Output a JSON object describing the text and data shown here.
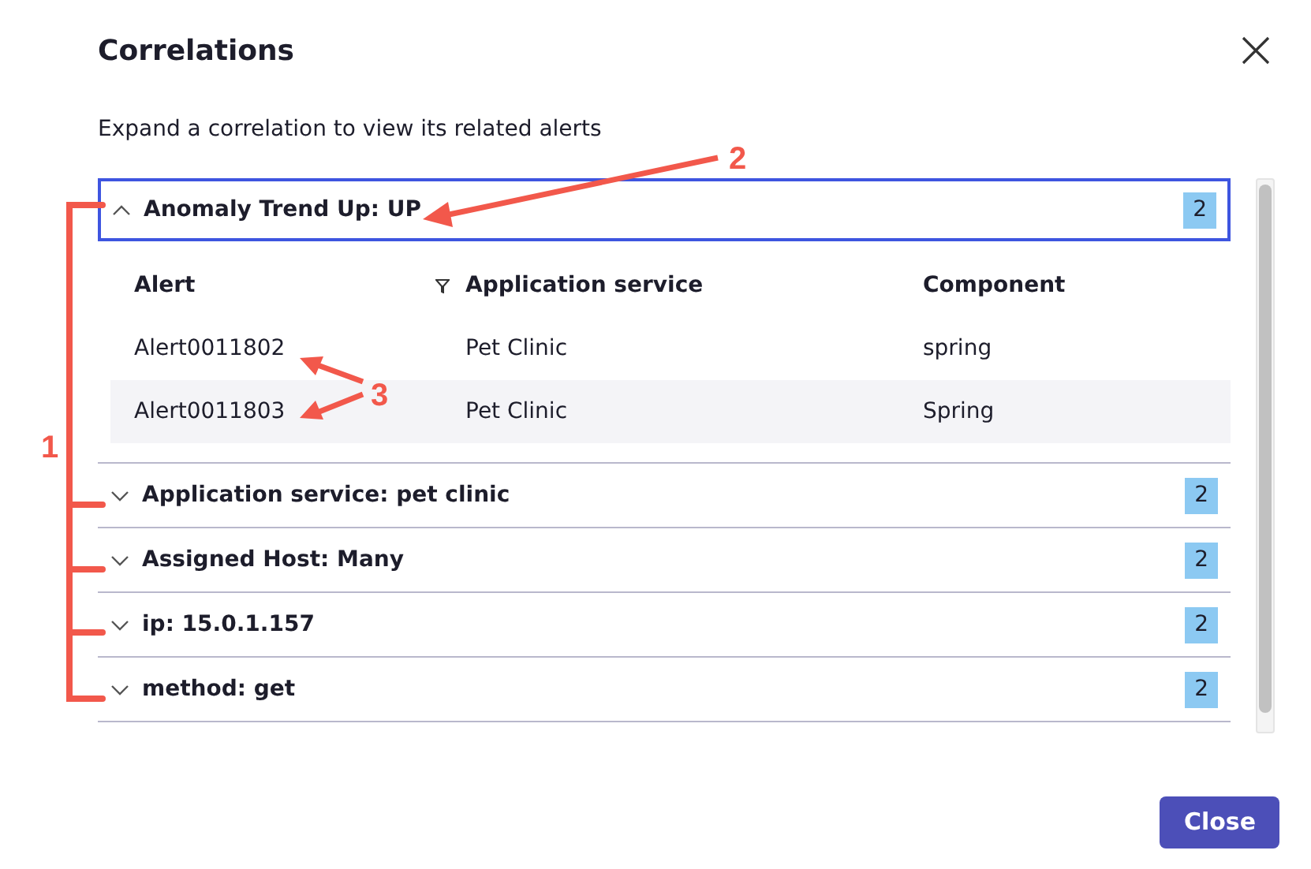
{
  "dialog": {
    "title": "Correlations",
    "subtitle": "Expand a correlation to view its related alerts",
    "correlations": [
      {
        "label": "Anomaly Trend Up: UP",
        "count": "2",
        "expanded": true,
        "selected": true,
        "table": {
          "columns": [
            "Alert",
            "Application service",
            "Component"
          ],
          "rows": [
            [
              "Alert0011802",
              "Pet Clinic",
              "spring"
            ],
            [
              "Alert0011803",
              "Pet Clinic",
              "Spring"
            ]
          ]
        }
      },
      {
        "label": "Application service: pet clinic",
        "count": "2",
        "expanded": false,
        "selected": false
      },
      {
        "label": "Assigned Host: Many",
        "count": "2",
        "expanded": false,
        "selected": false
      },
      {
        "label": "ip: 15.0.1.157",
        "count": "2",
        "expanded": false,
        "selected": false
      },
      {
        "label": "method: get",
        "count": "2",
        "expanded": false,
        "selected": false
      }
    ],
    "buttons": [
      "Close"
    ]
  },
  "annotations": [
    {
      "label": "1"
    },
    {
      "label": "2"
    },
    {
      "label": "3"
    }
  ]
}
